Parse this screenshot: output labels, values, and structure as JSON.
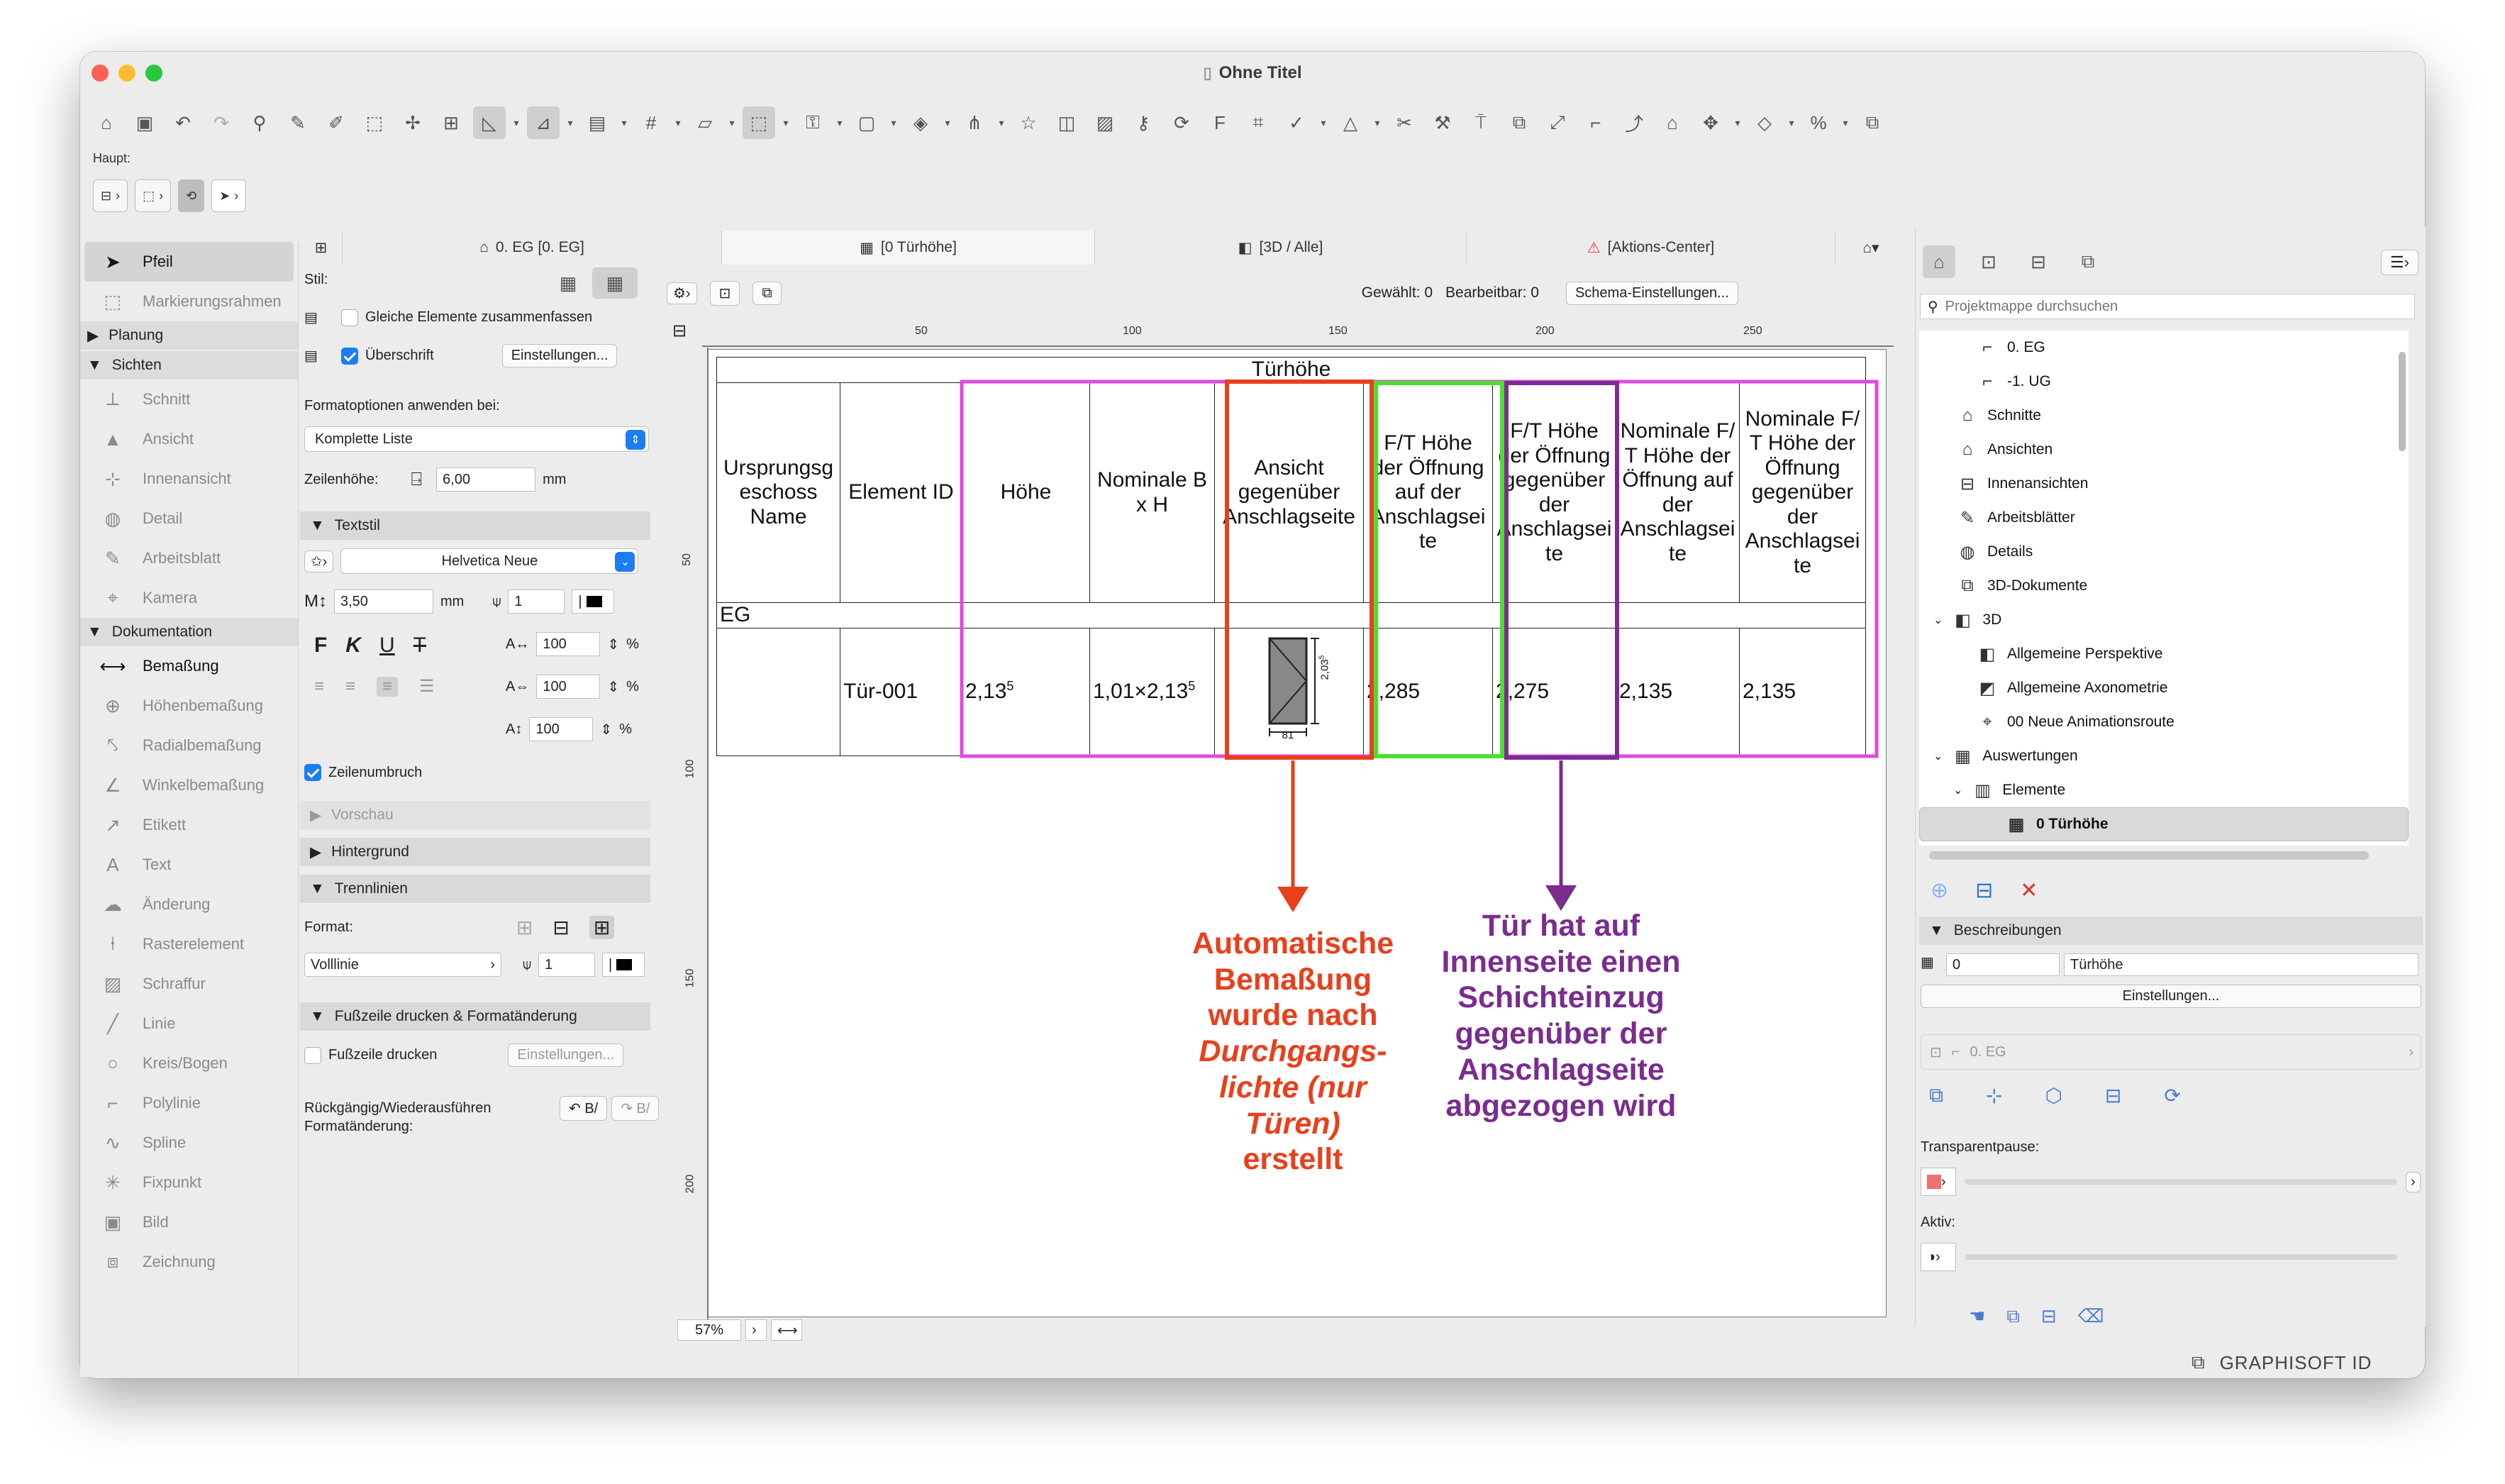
{
  "window": {
    "title": "Ohne Titel"
  },
  "haupt_label": "Haupt:",
  "left_toolbox": {
    "items": [
      {
        "label": "Pfeil",
        "icon": "arrow-pointer-icon",
        "active": true
      },
      {
        "label": "Markierungsrahmen",
        "icon": "marquee-icon"
      }
    ],
    "sections": {
      "planung": "Planung",
      "sichten": "Sichten",
      "dokumentation": "Dokumentation"
    },
    "sichten_items": [
      "Schnitt",
      "Ansicht",
      "Innenansicht",
      "Detail",
      "Arbeitsblatt",
      "Kamera"
    ],
    "doku_items": [
      "Bemaßung",
      "Höhenbemaßung",
      "Radialbemaßung",
      "Winkelbemaßung",
      "Etikett",
      "Text",
      "Änderung",
      "Rasterelement",
      "Schraffur",
      "Linie",
      "Kreis/Bogen",
      "Polylinie",
      "Spline",
      "Fixpunkt",
      "Bild",
      "Zeichnung"
    ]
  },
  "settings": {
    "stil_label": "Stil:",
    "gleiche_label": "Gleiche Elemente zusammenfassen",
    "ueberschrift_label": "Überschrift",
    "einstellungen_btn": "Einstellungen...",
    "formatoptionen_label": "Formatoptionen anwenden bei:",
    "formatoptionen_value": "Komplette Liste",
    "zeilenhoehe_label": "Zeilenhöhe:",
    "zeilenhoehe_value": "6,00",
    "zeilenhoehe_unit": "mm",
    "textstil_header": "Textstil",
    "font_value": "Helvetica Neue",
    "font_size_value": "3,50",
    "font_size_unit": "mm",
    "pen_value": "1",
    "scale1": "100",
    "scale2": "100",
    "scale3": "100",
    "percent": "%",
    "zeilenumbruch_label": "Zeilenumbruch",
    "vorschau_header": "Vorschau",
    "hintergrund_header": "Hintergrund",
    "trennlinien_header": "Trennlinien",
    "format_label": "Format:",
    "line_type_value": "Volllinie",
    "line_pen_value": "1",
    "fusszeile_header": "Fußzeile drucken & Formatänderung",
    "fusszeile_label": "Fußzeile drucken",
    "einstellungen_btn2": "Einstellungen...",
    "rueckgaengig_label": "Rückgängig/Wiederausführen Formatänderung:"
  },
  "tabs": [
    {
      "label": "0. EG [0. EG]",
      "icon": "floorplan-icon"
    },
    {
      "label": "[0 Türhöhe]",
      "icon": "schedule-icon"
    },
    {
      "label": "[3D / Alle]",
      "icon": "cube-icon"
    },
    {
      "label": "[Aktions-Center]",
      "icon": "action-center-icon"
    }
  ],
  "canvas_toolbar": {
    "gewaehlt": "Gewählt: 0",
    "bearbeitbar": "Bearbeitbar: 0",
    "schema_btn": "Schema-Einstellungen..."
  },
  "ruler": {
    "h_ticks": [
      "50",
      "100",
      "150",
      "200",
      "250"
    ],
    "v_ticks": [
      "50",
      "100",
      "150",
      "200"
    ]
  },
  "schedule": {
    "title": "Türhöhe",
    "headers": [
      "Ursprungsg eschoss Name",
      "Element ID",
      "Höhe",
      "Nominale B x H",
      "Ansicht gegenüber Anschlagseite",
      "F/T Höhe der Öffnung auf der Anschlagsei te",
      "F/T Höhe der Öffnung gegenüber der Anschlagsei te",
      "Nominale F/ T Höhe der Öffnung auf der Anschlagsei te",
      "Nominale F/ T Höhe der Öffnung gegenüber der Anschlagsei te"
    ],
    "group": "EG",
    "row": {
      "element_id": "Tür-001",
      "hoehe": "2,13",
      "hoehe_sup": "5",
      "nominal": "1,01×2,13",
      "nominal_sup": "5",
      "dim_h": "2,03",
      "dim_h_sup": "5",
      "dim_w": "81",
      "ft_anschlag": "2,285",
      "ft_gegenueber": "2,275",
      "nom_anschlag": "2,135",
      "nom_gegenueber": "2,135"
    }
  },
  "annotations": {
    "red_note_1": "Automatische Bemaßung wurde nach",
    "red_note_italic": "Durchgangs- lichte (nur Türen)",
    "red_note_2": "erstellt",
    "purple_note": "Tür hat auf Innenseite einen Schichteinzug gegenüber der Anschlagseite abgezogen wird",
    "red_color": "#e8401c",
    "purple_color": "#7a2c8f",
    "magenta_color": "#e04ae0",
    "green_color": "#49e02f"
  },
  "zoom": "57%",
  "navigator": {
    "search_placeholder": "Projektmappe durchsuchen",
    "tree": [
      {
        "label": "0. EG",
        "indent": 1
      },
      {
        "label": "-1. UG",
        "indent": 1
      },
      {
        "label": "Schnitte",
        "indent": 0
      },
      {
        "label": "Ansichten",
        "indent": 0
      },
      {
        "label": "Innenansichten",
        "indent": 0
      },
      {
        "label": "Arbeitsblätter",
        "indent": 0
      },
      {
        "label": "Details",
        "indent": 0
      },
      {
        "label": "3D-Dokumente",
        "indent": 0
      },
      {
        "label": "3D",
        "indent": 0
      },
      {
        "label": "Allgemeine Perspektive",
        "indent": 1
      },
      {
        "label": "Allgemeine Axonometrie",
        "indent": 1
      },
      {
        "label": "00 Neue Animationsroute",
        "indent": 1
      },
      {
        "label": "Auswertungen",
        "indent": 0
      },
      {
        "label": "Elemente",
        "indent": 1
      },
      {
        "label": "0 Türhöhe",
        "indent": 2
      }
    ],
    "beschreibungen_header": "Beschreibungen",
    "desc_id": "0",
    "desc_name": "Türhöhe",
    "einstellungen_btn": "Einstellungen...",
    "layer_value": "0. EG",
    "transparentpause_label": "Transparentpause:",
    "aktiv_label": "Aktiv:"
  },
  "footer": {
    "brand": "GRAPHISOFT ID"
  }
}
